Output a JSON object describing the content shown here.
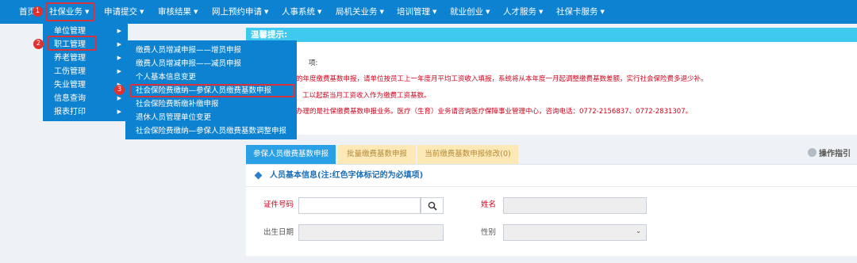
{
  "topnav": {
    "items": [
      {
        "label": "首页"
      },
      {
        "label": "社保业务"
      },
      {
        "label": "申请提交"
      },
      {
        "label": "审核结果"
      },
      {
        "label": "网上预约申请"
      },
      {
        "label": "人事系统"
      },
      {
        "label": "局机关业务"
      },
      {
        "label": "培训管理"
      },
      {
        "label": "就业创业"
      },
      {
        "label": "人才服务"
      },
      {
        "label": "社保卡服务"
      }
    ]
  },
  "badges": [
    "1",
    "2",
    "3"
  ],
  "menu": {
    "items": [
      {
        "label": "单位管理"
      },
      {
        "label": "职工管理"
      },
      {
        "label": "养老管理"
      },
      {
        "label": "工伤管理"
      },
      {
        "label": "失业管理"
      },
      {
        "label": "信息查询"
      },
      {
        "label": "报表打印"
      }
    ],
    "submenu": [
      {
        "label": "缴费人员增减申报——增员申报"
      },
      {
        "label": "缴费人员增减申报——减员申报"
      },
      {
        "label": "个人基本信息变更"
      },
      {
        "label": "社会保险费缴纳—参保人员缴费基数申报"
      },
      {
        "label": "社会保险费断缴补缴申报"
      },
      {
        "label": "退休人员管理单位变更"
      },
      {
        "label": "社会保险费缴纳—参保人员缴费基数调整申报"
      }
    ]
  },
  "notice": {
    "title": "温馨提示:",
    "lines": [
      "项:",
      "的年度缴费基数申报，请单位按员工上一年度月平均工资收入填报，系统将从本年度一月起调整缴费基数差额，实行社会保险费多退少补。",
      "工以起薪当月工资收入作为缴费工资基数。",
      "办理的是社保缴费基数申报业务。医疗（生育）业务请咨询医疗保障事业管理中心，咨询电话：0772-2156837、0772-2831307。"
    ]
  },
  "tabs": [
    {
      "label": "参保人员缴费基数申报"
    },
    {
      "label": "批量缴费基数申报"
    },
    {
      "label": "当前缴费基数申报修改(0)"
    }
  ],
  "guide": "操作指引",
  "form": {
    "title": "人员基本信息(注:红色字体标记的为必填项)",
    "id_label": "证件号码",
    "name_label": "姓名",
    "birth_label": "出生日期",
    "gender_label": "性别"
  },
  "colors": {
    "nav": "#0d82d1",
    "highlight": "#d8323c",
    "notice_header": "#3ec9ee",
    "tab_active": "#2aa0e6",
    "tab_inactive": "#fde9b6",
    "required": "#d0021b"
  },
  "icons": [
    "chevron-down-icon",
    "chevron-right-icon",
    "search-icon",
    "guide-icon",
    "diamond-icon"
  ]
}
